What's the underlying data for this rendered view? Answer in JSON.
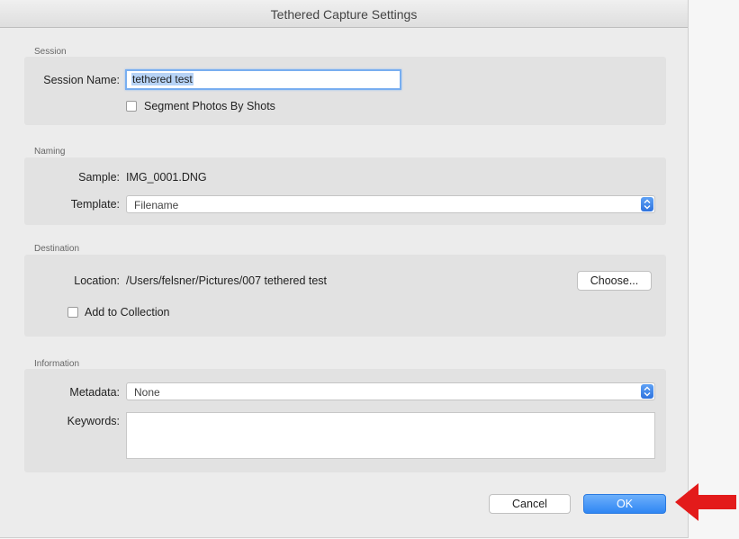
{
  "window": {
    "title": "Tethered Capture Settings"
  },
  "session": {
    "section_label": "Session",
    "name_label": "Session Name:",
    "name_value": "tethered test",
    "segment_label": "Segment Photos By Shots"
  },
  "naming": {
    "section_label": "Naming",
    "sample_label": "Sample:",
    "sample_value": "IMG_0001.DNG",
    "template_label": "Template:",
    "template_value": "Filename"
  },
  "destination": {
    "section_label": "Destination",
    "location_label": "Location:",
    "location_value": "/Users/felsner/Pictures/007 tethered test",
    "choose_label": "Choose...",
    "add_collection_label": "Add to Collection"
  },
  "information": {
    "section_label": "Information",
    "metadata_label": "Metadata:",
    "metadata_value": "None",
    "keywords_label": "Keywords:",
    "keywords_value": ""
  },
  "buttons": {
    "cancel": "Cancel",
    "ok": "OK"
  },
  "colors": {
    "primary": "#2f86f3",
    "annotation_arrow": "#e31b1b"
  }
}
